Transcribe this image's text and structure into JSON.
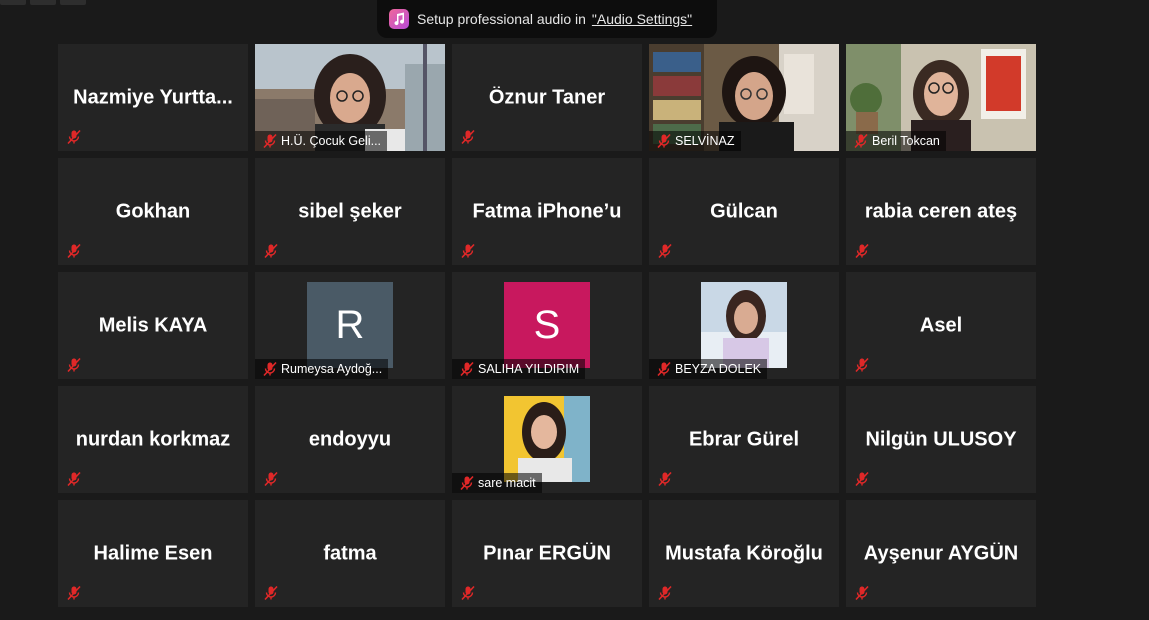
{
  "notice": {
    "text": "Setup professional audio in",
    "link": "\"Audio Settings\"",
    "icon": "music-note-icon"
  },
  "colors": {
    "tile_bg": "#242424",
    "active_border": "#cde33f",
    "mute_red": "#e02828",
    "avatar_r": "#4a5a66",
    "avatar_s": "#c8185e"
  },
  "participants": [
    {
      "name": "Nazmiye  Yurtta...",
      "type": "name"
    },
    {
      "name": "H.Ü. Çocuk Geli...",
      "type": "video"
    },
    {
      "name": "Öznur Taner",
      "type": "name"
    },
    {
      "name": "SELVİNAZ",
      "type": "video",
      "active": true
    },
    {
      "name": "Beril Tokcan",
      "type": "video"
    },
    {
      "name": "Gokhan",
      "type": "name"
    },
    {
      "name": "sibel şeker",
      "type": "name"
    },
    {
      "name": "Fatma iPhone’u",
      "type": "name"
    },
    {
      "name": "Gülcan",
      "type": "name"
    },
    {
      "name": "rabia ceren ateş",
      "type": "name"
    },
    {
      "name": "Melis KAYA",
      "type": "name"
    },
    {
      "name": "Rumeysa Aydoğ...",
      "type": "avatar",
      "initial": "R"
    },
    {
      "name": "SALIHA YILDIRIM",
      "type": "avatar",
      "initial": "S"
    },
    {
      "name": "BEYZA DOLEK",
      "type": "photo"
    },
    {
      "name": "Asel",
      "type": "name"
    },
    {
      "name": "nurdan korkmaz",
      "type": "name"
    },
    {
      "name": "endoyyu",
      "type": "name"
    },
    {
      "name": "sare macit",
      "type": "photo"
    },
    {
      "name": "Ebrar Gürel",
      "type": "name"
    },
    {
      "name": "Nilgün ULUSOY",
      "type": "name"
    },
    {
      "name": "Halime Esen",
      "type": "name"
    },
    {
      "name": "fatma",
      "type": "name"
    },
    {
      "name": "Pınar ERGÜN",
      "type": "name"
    },
    {
      "name": "Mustafa Köroğlu",
      "type": "name"
    },
    {
      "name": "Ayşenur AYGÜN",
      "type": "name"
    }
  ]
}
